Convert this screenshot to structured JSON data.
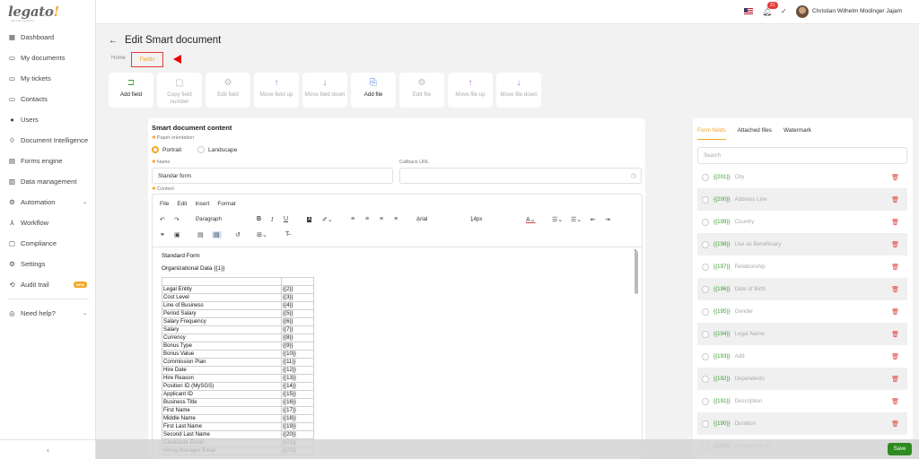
{
  "brand": {
    "name": "legato",
    "bang": "!",
    "tagline": "the smart workforce"
  },
  "nav": [
    {
      "label": "Dashboard",
      "icon": "grid-icon"
    },
    {
      "label": "My documents",
      "icon": "folder-icon"
    },
    {
      "label": "My tickets",
      "icon": "ticket-icon"
    },
    {
      "label": "Contacts",
      "icon": "contacts-icon"
    },
    {
      "label": "Users",
      "icon": "user-icon"
    },
    {
      "label": "Document Intelligence",
      "icon": "doc-intel-icon"
    },
    {
      "label": "Forms engine",
      "icon": "forms-icon"
    },
    {
      "label": "Data management",
      "icon": "data-icon"
    },
    {
      "label": "Automation",
      "icon": "automation-icon"
    },
    {
      "label": "Workflow",
      "icon": "workflow-icon"
    },
    {
      "label": "Compliance",
      "icon": "compliance-icon"
    },
    {
      "label": "Settings",
      "icon": "gear-icon"
    },
    {
      "label": "Audit trail",
      "icon": "audit-icon",
      "badge": "NEW"
    },
    {
      "label": "Need help?",
      "icon": "help-icon"
    }
  ],
  "topbar": {
    "notifications": "21",
    "user": "Christian Wilhelm Modinger Jajam"
  },
  "page": {
    "title": "Edit Smart document",
    "breadcrumb_home": "Home",
    "breadcrumb_current": "Fields"
  },
  "toolbar": [
    {
      "label": "Add field",
      "icon": "add-field-icon",
      "enabled": true
    },
    {
      "label": "Copy field number",
      "icon": "copy-icon",
      "enabled": false
    },
    {
      "label": "Edit field",
      "icon": "gear-icon",
      "enabled": false
    },
    {
      "label": "Move field up",
      "icon": "arrow-up-icon",
      "enabled": false
    },
    {
      "label": "Move field down",
      "icon": "arrow-down-icon",
      "enabled": false
    },
    {
      "label": "Add file",
      "icon": "add-file-icon",
      "enabled": true
    },
    {
      "label": "Edit file",
      "icon": "gear-icon",
      "enabled": false
    },
    {
      "label": "Move file up",
      "icon": "arrow-up-icon",
      "enabled": false
    },
    {
      "label": "Move file down",
      "icon": "arrow-down-icon",
      "enabled": false
    }
  ],
  "form": {
    "section_title": "Smart document content",
    "orientation_label": "Paper orientation",
    "portrait": "Portrait",
    "landscape": "Landscape",
    "name_label": "Name",
    "name_value": "Standar form",
    "callback_label": "Callback URL",
    "callback_value": "",
    "content_label": "Content"
  },
  "editor": {
    "menus": [
      "File",
      "Edit",
      "Insert",
      "Format"
    ],
    "block": "Paragraph",
    "font": "Arial",
    "size": "14px",
    "doc_title": "Standard Form",
    "doc_subtitle": "Organizational Data  {{1}}",
    "rows": [
      {
        "label": "Legal Entity",
        "code": "{{2}}"
      },
      {
        "label": "Cost Level",
        "code": "{{3}}"
      },
      {
        "label": "Line of Business",
        "code": "{{4}}"
      },
      {
        "label": "Period Salary",
        "code": "{{5}}"
      },
      {
        "label": "Salary Frequency",
        "code": "{{6}}"
      },
      {
        "label": "Salary",
        "code": "{{7}}"
      },
      {
        "label": "Currency",
        "code": "{{8}}"
      },
      {
        "label": "Bonus Type",
        "code": "{{9}}"
      },
      {
        "label": "Bonus Value",
        "code": "{{10}}"
      },
      {
        "label": "Commission Plan",
        "code": "{{11}}"
      },
      {
        "label": "Hire Date",
        "code": "{{12}}"
      },
      {
        "label": "Hire Reason",
        "code": "{{13}}"
      },
      {
        "label": "Position ID (MySGS)",
        "code": "{{14}}"
      },
      {
        "label": "Applicant ID",
        "code": "{{15}}"
      },
      {
        "label": "Business Title",
        "code": "{{16}}"
      },
      {
        "label": "First Name",
        "code": "{{17}}"
      },
      {
        "label": "Middle Name",
        "code": "{{18}}"
      },
      {
        "label": "First Last Name",
        "code": "{{19}}"
      },
      {
        "label": "Second Last Name",
        "code": "{{20}}"
      },
      {
        "label": "Candidate Email",
        "code": "{{21}}"
      },
      {
        "label": "Hiring Manager Email",
        "code": "{{22}}"
      }
    ]
  },
  "side": {
    "tabs": [
      "Form fields",
      "Attached files",
      "Watermark"
    ],
    "search_placeholder": "Search",
    "fields": [
      {
        "code": "{{201}}",
        "name": "City"
      },
      {
        "code": "{{200}}",
        "name": "Address Line"
      },
      {
        "code": "{{199}}",
        "name": "Country"
      },
      {
        "code": "{{198}}",
        "name": "Use as Beneficiary"
      },
      {
        "code": "{{197}}",
        "name": "Relationship"
      },
      {
        "code": "{{196}}",
        "name": "Date of Birth"
      },
      {
        "code": "{{195}}",
        "name": "Gender"
      },
      {
        "code": "{{194}}",
        "name": "Legal Name"
      },
      {
        "code": "{{193}}",
        "name": "Add"
      },
      {
        "code": "{{192}}",
        "name": "Dependents"
      },
      {
        "code": "{{191}}",
        "name": "Description"
      },
      {
        "code": "{{190}}",
        "name": "Duration"
      },
      {
        "code": "{{189}}",
        "name": "Completed On"
      }
    ]
  },
  "footer": {
    "save": "Save"
  }
}
